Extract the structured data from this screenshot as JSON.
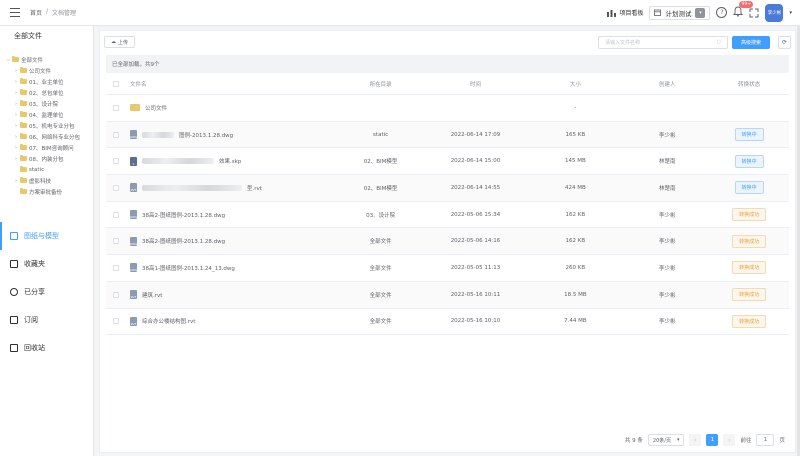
{
  "breadcrumb": {
    "home": "首页",
    "sep": "/",
    "current": "文档管理"
  },
  "header": {
    "board_label": "项目看板",
    "plan_select_value": "计划测试",
    "notification_count": "99+",
    "avatar_text": "李少彬"
  },
  "sidebar": {
    "title": "全部文件",
    "tree_root": "全部文件",
    "tree_items": [
      "公司文件",
      "01、业主单位",
      "02、总包单位",
      "03、设计院",
      "04、监理单位",
      "05、机电专业分包",
      "06、网络科专业分包",
      "07、BIM咨询顾问",
      "08、内装分包",
      "static",
      "虚影科技",
      "方案审批备份"
    ],
    "nav": [
      "图纸与模型",
      "收藏夹",
      "已分享",
      "订阅",
      "回收站"
    ]
  },
  "toolbar": {
    "upload_label": "上传",
    "search_placeholder": "请输入文件名称",
    "search_button": "高级搜索"
  },
  "loaded_text": "已全部加载，共9个",
  "table": {
    "headers": [
      "文件名",
      "所在目录",
      "时间",
      "大小",
      "创建人",
      "转换状态"
    ],
    "rows": [
      {
        "type": "folder",
        "name": "公司文件",
        "dir": "",
        "time": "",
        "size": "-",
        "creator": "",
        "status": ""
      },
      {
        "type": "dwg",
        "name": "图例-2013.1.28.dwg",
        "blur": true,
        "dir": "static",
        "time": "2022-06-14 17:09",
        "size": "165 KB",
        "creator": "李少彬",
        "status": "转换中",
        "status_type": "converting"
      },
      {
        "type": "skp",
        "name": "效果.skp",
        "blur": true,
        "dir": "02、BIM模型",
        "time": "2022-06-14 15:00",
        "size": "145 MB",
        "creator": "林楚南",
        "status": "转换中",
        "status_type": "converting"
      },
      {
        "type": "rvt",
        "name": "型.rvt",
        "blur": true,
        "dir": "02、BIM模型",
        "time": "2022-06-14 14:55",
        "size": "424 MB",
        "creator": "林楚南",
        "status": "转换中",
        "status_type": "converting"
      },
      {
        "type": "dwg",
        "name": "38高2-图纸图例-2013.1.28.dwg",
        "dir": "03、设计院",
        "time": "2022-05-06 15:34",
        "size": "162 KB",
        "creator": "李少彬",
        "status": "转换成功",
        "status_type": "success"
      },
      {
        "type": "dwg",
        "name": "38高2-图纸图例-2013.1.28.dwg",
        "dir": "全部文件",
        "time": "2022-05-06 14:16",
        "size": "162 KB",
        "creator": "李少彬",
        "status": "转换成功",
        "status_type": "success"
      },
      {
        "type": "dwg",
        "name": "38高1-图纸图例-2013.1.24_13.dwg",
        "dir": "全部文件",
        "time": "2022-05-05 11:13",
        "size": "260 KB",
        "creator": "李少彬",
        "status": "转换成功",
        "status_type": "success"
      },
      {
        "type": "rvt",
        "name": "建筑.rvt",
        "dir": "全部文件",
        "time": "2022-05-16 10:11",
        "size": "18.5 MB",
        "creator": "李少彬",
        "status": "转换成功",
        "status_type": "success"
      },
      {
        "type": "rvt",
        "name": "综合办公楼结构图.rvt",
        "dir": "全部文件",
        "time": "2022-05-16 10:10",
        "size": "7.44 MB",
        "creator": "李少彬",
        "status": "转换成功",
        "status_type": "success"
      }
    ]
  },
  "pagination": {
    "total": "共 9 条",
    "page_size": "20条/页",
    "current_page": "1",
    "goto_label": "前往",
    "goto_value": "1",
    "page_unit": "页"
  }
}
